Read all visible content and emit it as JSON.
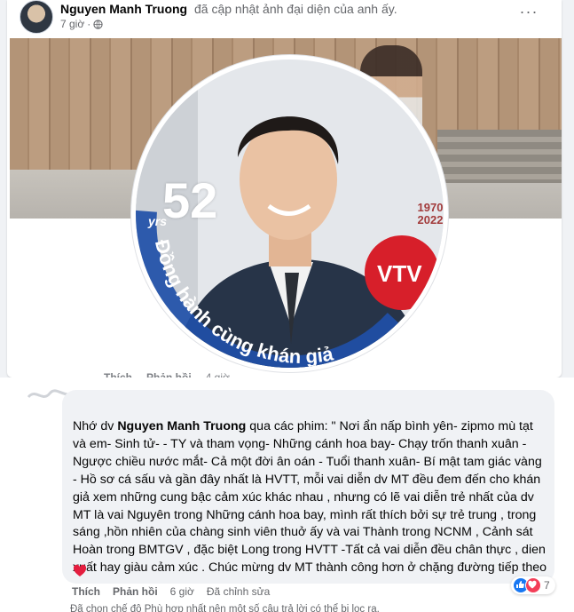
{
  "post": {
    "author": "Nguyen Manh Truong",
    "action": "đã cập nhật ảnh đại diện của anh ấy.",
    "time": "7 giờ",
    "privacy_icon": "globe-icon",
    "more_icon": "more-options-icon"
  },
  "profile_badge": {
    "number": "52",
    "unit": "yrs",
    "years": "1970\n2022",
    "slogan": "Đồng hành cùng khán giả",
    "logo": "VTV"
  },
  "hidden_actions": {
    "like": "Thích",
    "reply": "Phản hồi",
    "time": "4 giờ"
  },
  "comment": {
    "prefix": "Nhớ dv ",
    "mention": "Nguyen Manh Truong",
    "body": " qua các phim: \" Nơi ẩn nấp bình yên- zipmo mù tạt và em- Sinh tử- - TY và tham vọng- Những cánh hoa bay- Chạy trốn thanh xuân - Ngược chiều nước mắt- Cả một đời ân oán - Tuổi thanh xuân- Bí mật tam giác vàng - Hồ sơ cá sấu và gần đây nhất là HVTT, mỗi vai diễn dv MT đều đem đến cho khán giả xem những cung bậc cảm xúc khác nhau , nhưng có lẽ vai diễn trẻ nhất của dv MT là vai Nguyên trong Những cánh hoa bay, mình rất thích bởi sự trẻ trung , trong sáng ,hồn nhiên của chàng sinh viên thuở ấy và vai Thành trong NCNM , Cảnh sát Hoàn trong BMTGV , đặc biệt Long trong HVTT -Tất cả vai diễn đều chân thực , dien xuất hay giàu cảm xúc . Chúc mừng dv MT thành công hơn ở chặng đường tiếp theo",
    "like": "Thích",
    "reply": "Phản hồi",
    "time": "6 giờ",
    "edited": "Đã chỉnh sửa",
    "reaction_count": "7",
    "footer": "Đã chọn chế độ Phù hợp nhất nên một số câu trả lời có thể bị lọc ra."
  },
  "colors": {
    "facebook_blue": "#1877f2",
    "love_red": "#f33e58",
    "vtv_red": "#d71f2a",
    "badge_blue": "#1f4fa8"
  }
}
